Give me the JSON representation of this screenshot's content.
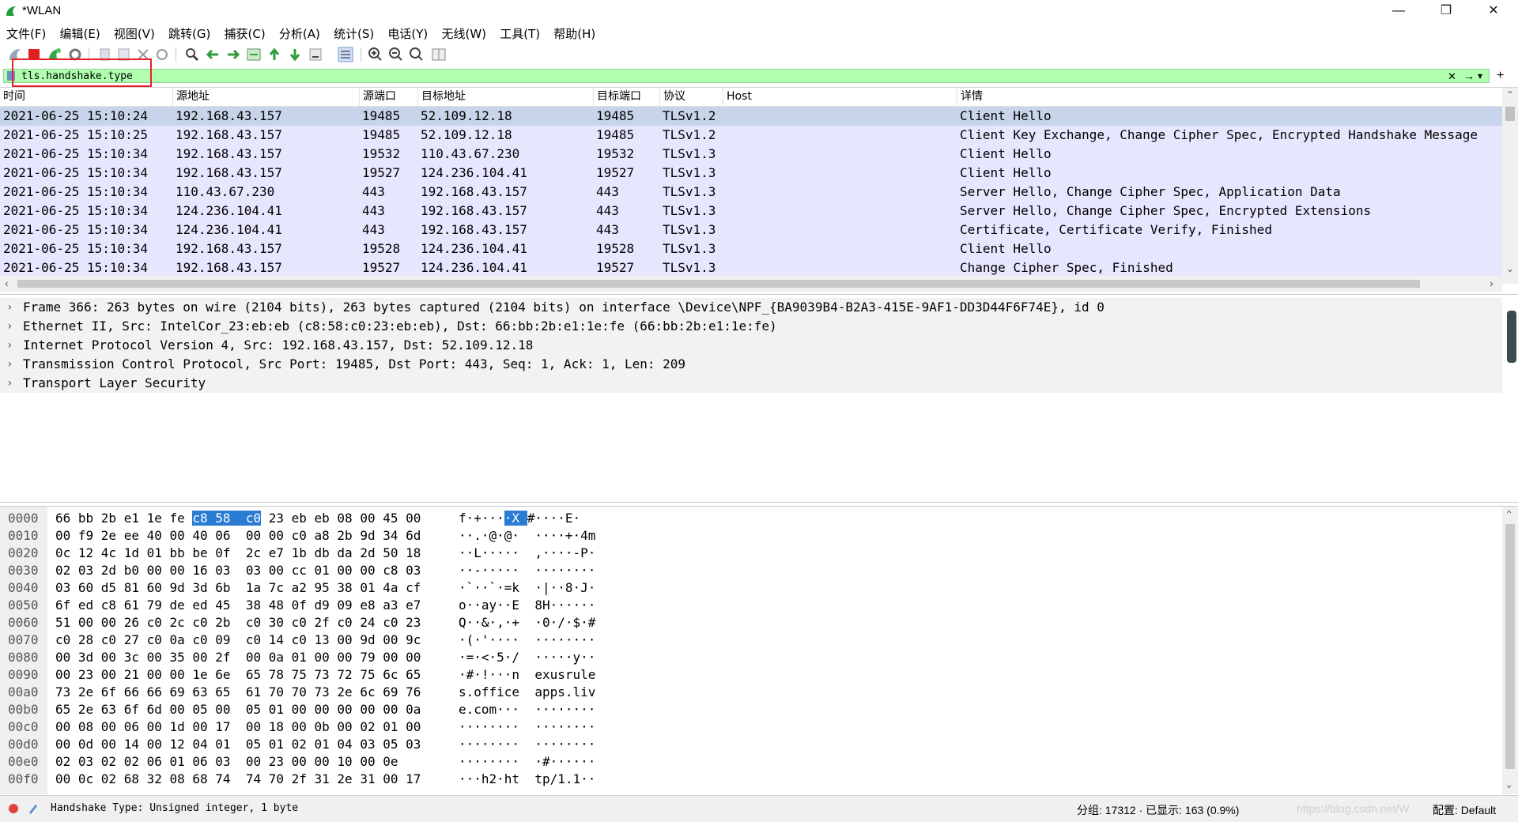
{
  "window": {
    "title": "*WLAN",
    "minimize": "—",
    "restore": "❐",
    "close": "✕"
  },
  "menu": [
    "文件(F)",
    "编辑(E)",
    "视图(V)",
    "跳转(G)",
    "捕获(C)",
    "分析(A)",
    "统计(S)",
    "电话(Y)",
    "无线(W)",
    "工具(T)",
    "帮助(H)"
  ],
  "filter": {
    "value": "tls.handshake.type",
    "clear_icon": "✕",
    "apply_icon": "→",
    "dropdown_icon": "▾",
    "add_icon": "+"
  },
  "packet_list": {
    "columns": [
      "时间",
      "源地址",
      "源端口",
      "目标地址",
      "目标端口",
      "协议",
      "Host",
      "详情"
    ],
    "rows": [
      [
        "2021-06-25 15:10:24",
        "192.168.43.157",
        "19485",
        "52.109.12.18",
        "19485",
        "TLSv1.2",
        "",
        "Client Hello"
      ],
      [
        "2021-06-25 15:10:25",
        "192.168.43.157",
        "19485",
        "52.109.12.18",
        "19485",
        "TLSv1.2",
        "",
        "Client Key Exchange, Change Cipher Spec, Encrypted Handshake Message"
      ],
      [
        "2021-06-25 15:10:34",
        "192.168.43.157",
        "19532",
        "110.43.67.230",
        "19532",
        "TLSv1.3",
        "",
        "Client Hello"
      ],
      [
        "2021-06-25 15:10:34",
        "192.168.43.157",
        "19527",
        "124.236.104.41",
        "19527",
        "TLSv1.3",
        "",
        "Client Hello"
      ],
      [
        "2021-06-25 15:10:34",
        "110.43.67.230",
        "443",
        "192.168.43.157",
        "443",
        "TLSv1.3",
        "",
        "Server Hello, Change Cipher Spec, Application Data"
      ],
      [
        "2021-06-25 15:10:34",
        "124.236.104.41",
        "443",
        "192.168.43.157",
        "443",
        "TLSv1.3",
        "",
        "Server Hello, Change Cipher Spec, Encrypted Extensions"
      ],
      [
        "2021-06-25 15:10:34",
        "124.236.104.41",
        "443",
        "192.168.43.157",
        "443",
        "TLSv1.3",
        "",
        "Certificate, Certificate Verify, Finished"
      ],
      [
        "2021-06-25 15:10:34",
        "192.168.43.157",
        "19528",
        "124.236.104.41",
        "19528",
        "TLSv1.3",
        "",
        "Client Hello"
      ],
      [
        "2021-06-25 15:10:34",
        "192.168.43.157",
        "19527",
        "124.236.104.41",
        "19527",
        "TLSv1.3",
        "",
        "Change Cipher Spec, Finished"
      ]
    ]
  },
  "details": [
    "Frame 366: 263 bytes on wire (2104 bits), 263 bytes captured (2104 bits) on interface \\Device\\NPF_{BA9039B4-B2A3-415E-9AF1-DD3D44F6F74E}, id 0",
    "Ethernet II, Src: IntelCor_23:eb:eb (c8:58:c0:23:eb:eb), Dst: 66:bb:2b:e1:1e:fe (66:bb:2b:e1:1e:fe)",
    "Internet Protocol Version 4, Src: 192.168.43.157, Dst: 52.109.12.18",
    "Transmission Control Protocol, Src Port: 19485, Dst Port: 443, Seq: 1, Ack: 1, Len: 209",
    "Transport Layer Security"
  ],
  "bytes": [
    {
      "off": "0000",
      "hex_a": "66 bb 2b e1 1e fe ",
      "hex_hl": "c8 58  c0",
      "hex_b": " 23 eb eb 08 00 45 00",
      "asc_a": "f·+···",
      "asc_hl": "·X ",
      "asc_b": "#····E·"
    },
    {
      "off": "0010",
      "hex": "00 f9 2e ee 40 00 40 06  00 00 c0 a8 2b 9d 34 6d",
      "asc": "··.·@·@·  ····+·4m"
    },
    {
      "off": "0020",
      "hex": "0c 12 4c 1d 01 bb be 0f  2c e7 1b db da 2d 50 18",
      "asc": "··L·····  ,····-P·"
    },
    {
      "off": "0030",
      "hex": "02 03 2d b0 00 00 16 03  03 00 cc 01 00 00 c8 03",
      "asc": "··-·····  ········"
    },
    {
      "off": "0040",
      "hex": "03 60 d5 81 60 9d 3d 6b  1a 7c a2 95 38 01 4a cf",
      "asc": "·`··`·=k  ·|··8·J·"
    },
    {
      "off": "0050",
      "hex": "6f ed c8 61 79 de ed 45  38 48 0f d9 09 e8 a3 e7",
      "asc": "o··ay··E  8H······"
    },
    {
      "off": "0060",
      "hex": "51 00 00 26 c0 2c c0 2b  c0 30 c0 2f c0 24 c0 23",
      "asc": "Q··&·,·+  ·0·/·$·#"
    },
    {
      "off": "0070",
      "hex": "c0 28 c0 27 c0 0a c0 09  c0 14 c0 13 00 9d 00 9c",
      "asc": "·(·'····  ········"
    },
    {
      "off": "0080",
      "hex": "00 3d 00 3c 00 35 00 2f  00 0a 01 00 00 79 00 00",
      "asc": "·=·<·5·/  ·····y··"
    },
    {
      "off": "0090",
      "hex": "00 23 00 21 00 00 1e 6e  65 78 75 73 72 75 6c 65",
      "asc": "·#·!···n  exusrule"
    },
    {
      "off": "00a0",
      "hex": "73 2e 6f 66 66 69 63 65  61 70 70 73 2e 6c 69 76",
      "asc": "s.office  apps.liv"
    },
    {
      "off": "00b0",
      "hex": "65 2e 63 6f 6d 00 05 00  05 01 00 00 00 00 00 0a",
      "asc": "e.com···  ········"
    },
    {
      "off": "00c0",
      "hex": "00 08 00 06 00 1d 00 17  00 18 00 0b 00 02 01 00",
      "asc": "········  ········"
    },
    {
      "off": "00d0",
      "hex": "00 0d 00 14 00 12 04 01  05 01 02 01 04 03 05 03",
      "asc": "········  ········"
    },
    {
      "off": "00e0",
      "hex": "02 03 02 02 06 01 06 03  00 23 00 00 10 00 0e",
      "asc": "········  ·#······"
    },
    {
      "off": "00f0",
      "hex": "00 0c 02 68 32 08 68 74  74 70 2f 31 2e 31 00 17",
      "asc": "···h2·ht  tp/1.1··"
    }
  ],
  "status": {
    "field_info": "Handshake Type: Unsigned integer, 1 byte",
    "packets": "分组: 17312 · 已显示: 163 (0.9%)",
    "watermark": "https://blog.csdn.net/W",
    "profile": "配置: Default"
  },
  "colors": {
    "filter_ok": "#afffaf",
    "row_bg": "#e7e6ff",
    "row_selected": "#c7d4ea",
    "byte_highlight": "#2a7bd4"
  }
}
